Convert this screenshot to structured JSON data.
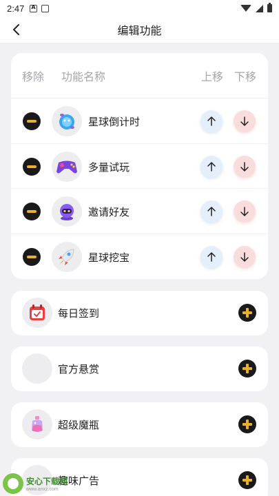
{
  "status_bar": {
    "time": "2:47"
  },
  "nav": {
    "title": "编辑功能"
  },
  "table_header": {
    "remove": "移除",
    "name": "功能名称",
    "move_up": "上移",
    "move_down": "下移"
  },
  "active_features": [
    {
      "label": "星球倒计时",
      "icon": "planet-timer-icon"
    },
    {
      "label": "多量试玩",
      "icon": "gamepad-icon"
    },
    {
      "label": "邀请好友",
      "icon": "robot-icon"
    },
    {
      "label": "星球挖宝",
      "icon": "rocket-icon"
    }
  ],
  "available_features": [
    {
      "label": "每日签到",
      "icon": "calendar-icon"
    },
    {
      "label": "官方悬赏",
      "icon": "empty-icon"
    },
    {
      "label": "超级魔瓶",
      "icon": "potion-bottle-icon"
    },
    {
      "label": "趣味广告",
      "icon": "empty-icon"
    }
  ],
  "watermark": {
    "main": "安心下载网",
    "sub": "www.anxz.com"
  },
  "colors": {
    "accent": "#e8b02d",
    "up": "#e4effb",
    "down": "#f9dcdc",
    "page_bg": "#f1f1f3"
  }
}
